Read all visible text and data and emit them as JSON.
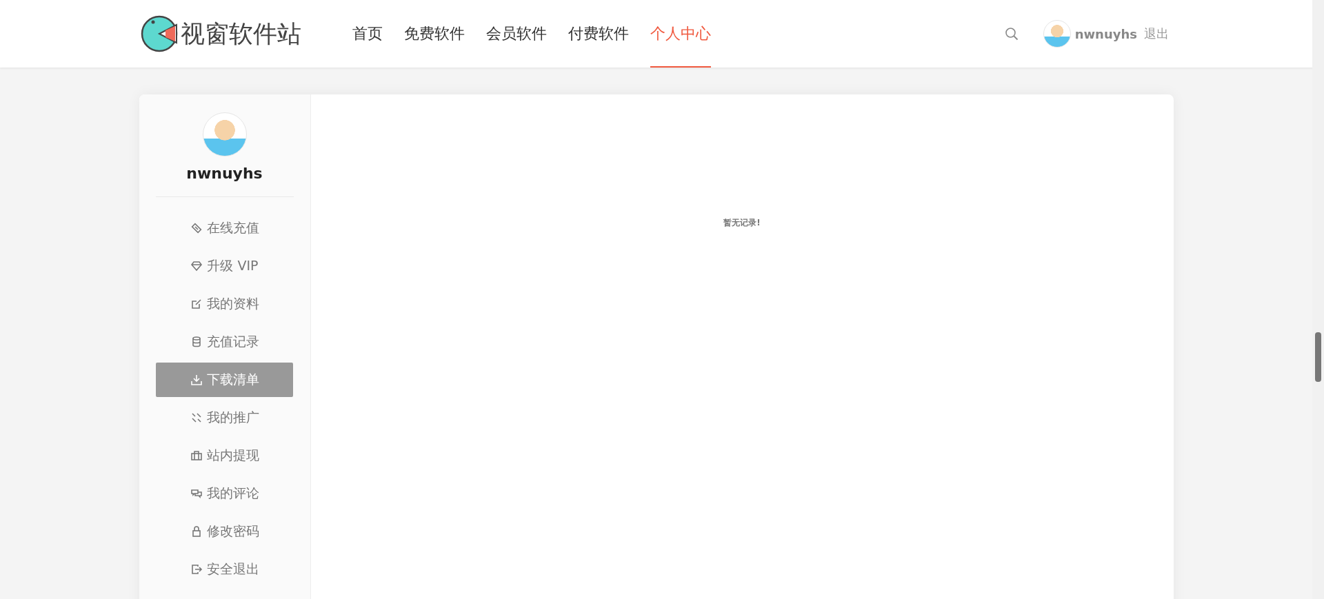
{
  "header": {
    "logo_text": "视窗软件站",
    "nav": [
      {
        "label": "首页",
        "selected": false
      },
      {
        "label": "免费软件",
        "selected": false
      },
      {
        "label": "会员软件",
        "selected": false
      },
      {
        "label": "付费软件",
        "selected": false
      },
      {
        "label": "个人中心",
        "selected": true
      }
    ],
    "username": "nwnuyhs",
    "logout": "退出"
  },
  "sidebar": {
    "username": "nwnuyhs",
    "items": [
      {
        "label": "在线充值",
        "selected": false
      },
      {
        "label": "升级 VIP",
        "selected": false
      },
      {
        "label": "我的资料",
        "selected": false
      },
      {
        "label": "充值记录",
        "selected": false
      },
      {
        "label": "下载清单",
        "selected": true
      },
      {
        "label": "我的推广",
        "selected": false
      },
      {
        "label": "站内提现",
        "selected": false
      },
      {
        "label": "我的评论",
        "selected": false
      },
      {
        "label": "修改密码",
        "selected": false
      },
      {
        "label": "安全退出",
        "selected": false
      }
    ]
  },
  "content": {
    "empty_message": "暂无记录!"
  }
}
